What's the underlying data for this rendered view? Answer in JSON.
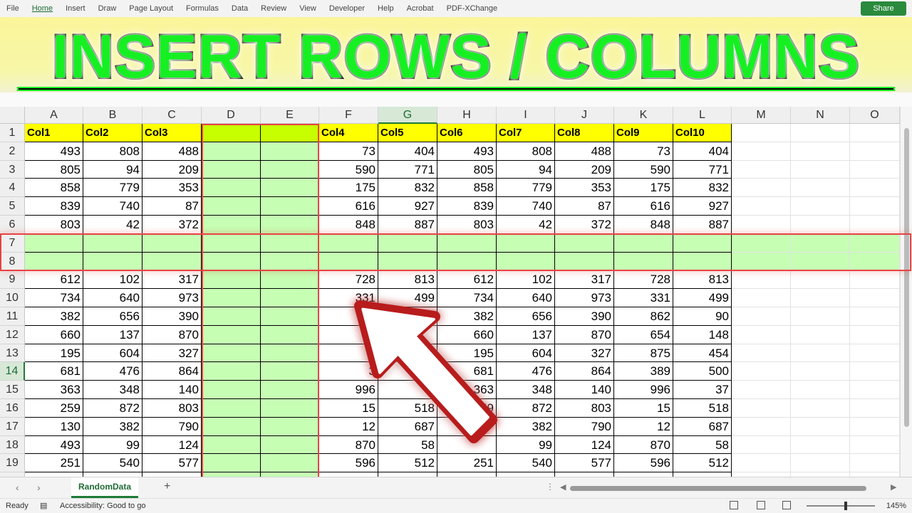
{
  "ribbon": {
    "tabs": [
      "File",
      "Home",
      "Insert",
      "Draw",
      "Page Layout",
      "Formulas",
      "Data",
      "Review",
      "View",
      "Developer",
      "Help",
      "Acrobat",
      "PDF-XChange"
    ],
    "active_tab": "Home",
    "share_label": "Share"
  },
  "title": "INSERT ROWS / COLUMNS",
  "colors": {
    "banner_green": "#16f023",
    "highlight_green": "#c6ffb4",
    "header_yellow": "#ffff00",
    "frame_red": "#e84343",
    "excel_green": "#1e7b35"
  },
  "grid": {
    "columns": [
      "A",
      "B",
      "C",
      "D",
      "E",
      "F",
      "G",
      "H",
      "I",
      "J",
      "K",
      "L",
      "M",
      "N",
      "O"
    ],
    "selected_column": "G",
    "selected_row": "14",
    "inserted_columns": [
      "D",
      "E"
    ],
    "inserted_rows": [
      "7",
      "8"
    ],
    "headers": [
      "Col1",
      "Col2",
      "Col3",
      "",
      "",
      "Col4",
      "Col5",
      "Col6",
      "Col7",
      "Col8",
      "Col9",
      "Col10"
    ],
    "rows": [
      {
        "n": "2",
        "v": [
          "493",
          "808",
          "488",
          "",
          "",
          "73",
          "404",
          "493",
          "808",
          "488",
          "73",
          "404"
        ]
      },
      {
        "n": "3",
        "v": [
          "805",
          "94",
          "209",
          "",
          "",
          "590",
          "771",
          "805",
          "94",
          "209",
          "590",
          "771"
        ]
      },
      {
        "n": "4",
        "v": [
          "858",
          "779",
          "353",
          "",
          "",
          "175",
          "832",
          "858",
          "779",
          "353",
          "175",
          "832"
        ]
      },
      {
        "n": "5",
        "v": [
          "839",
          "740",
          "87",
          "",
          "",
          "616",
          "927",
          "839",
          "740",
          "87",
          "616",
          "927"
        ]
      },
      {
        "n": "6",
        "v": [
          "803",
          "42",
          "372",
          "",
          "",
          "848",
          "887",
          "803",
          "42",
          "372",
          "848",
          "887"
        ]
      },
      {
        "n": "7",
        "v": [
          "",
          "",
          "",
          "",
          "",
          "",
          "",
          "",
          "",
          "",
          "",
          ""
        ]
      },
      {
        "n": "8",
        "v": [
          "",
          "",
          "",
          "",
          "",
          "",
          "",
          "",
          "",
          "",
          "",
          ""
        ]
      },
      {
        "n": "9",
        "v": [
          "612",
          "102",
          "317",
          "",
          "",
          "728",
          "813",
          "612",
          "102",
          "317",
          "728",
          "813"
        ]
      },
      {
        "n": "10",
        "v": [
          "734",
          "640",
          "973",
          "",
          "",
          "331",
          "499",
          "734",
          "640",
          "973",
          "331",
          "499"
        ]
      },
      {
        "n": "11",
        "v": [
          "382",
          "656",
          "390",
          "",
          "",
          "",
          "",
          "382",
          "656",
          "390",
          "862",
          "90"
        ]
      },
      {
        "n": "12",
        "v": [
          "660",
          "137",
          "870",
          "",
          "",
          "",
          "",
          "660",
          "137",
          "870",
          "654",
          "148"
        ]
      },
      {
        "n": "13",
        "v": [
          "195",
          "604",
          "327",
          "",
          "",
          "8",
          "54",
          "195",
          "604",
          "327",
          "875",
          "454"
        ]
      },
      {
        "n": "14",
        "v": [
          "681",
          "476",
          "864",
          "",
          "",
          "3",
          "",
          "681",
          "476",
          "864",
          "389",
          "500"
        ]
      },
      {
        "n": "15",
        "v": [
          "363",
          "348",
          "140",
          "",
          "",
          "996",
          "",
          "363",
          "348",
          "140",
          "996",
          "37"
        ]
      },
      {
        "n": "16",
        "v": [
          "259",
          "872",
          "803",
          "",
          "",
          "15",
          "518",
          "259",
          "872",
          "803",
          "15",
          "518"
        ]
      },
      {
        "n": "17",
        "v": [
          "130",
          "382",
          "790",
          "",
          "",
          "12",
          "687",
          "",
          "382",
          "790",
          "12",
          "687"
        ]
      },
      {
        "n": "18",
        "v": [
          "493",
          "99",
          "124",
          "",
          "",
          "870",
          "58",
          "",
          "99",
          "124",
          "870",
          "58"
        ]
      },
      {
        "n": "19",
        "v": [
          "251",
          "540",
          "577",
          "",
          "",
          "596",
          "512",
          "251",
          "540",
          "577",
          "596",
          "512"
        ]
      }
    ]
  },
  "sheet_tab": "RandomData",
  "add_sheet_symbol": "+",
  "status": {
    "ready": "Ready",
    "accessibility": "Accessibility: Good to go",
    "zoom": "145%"
  }
}
